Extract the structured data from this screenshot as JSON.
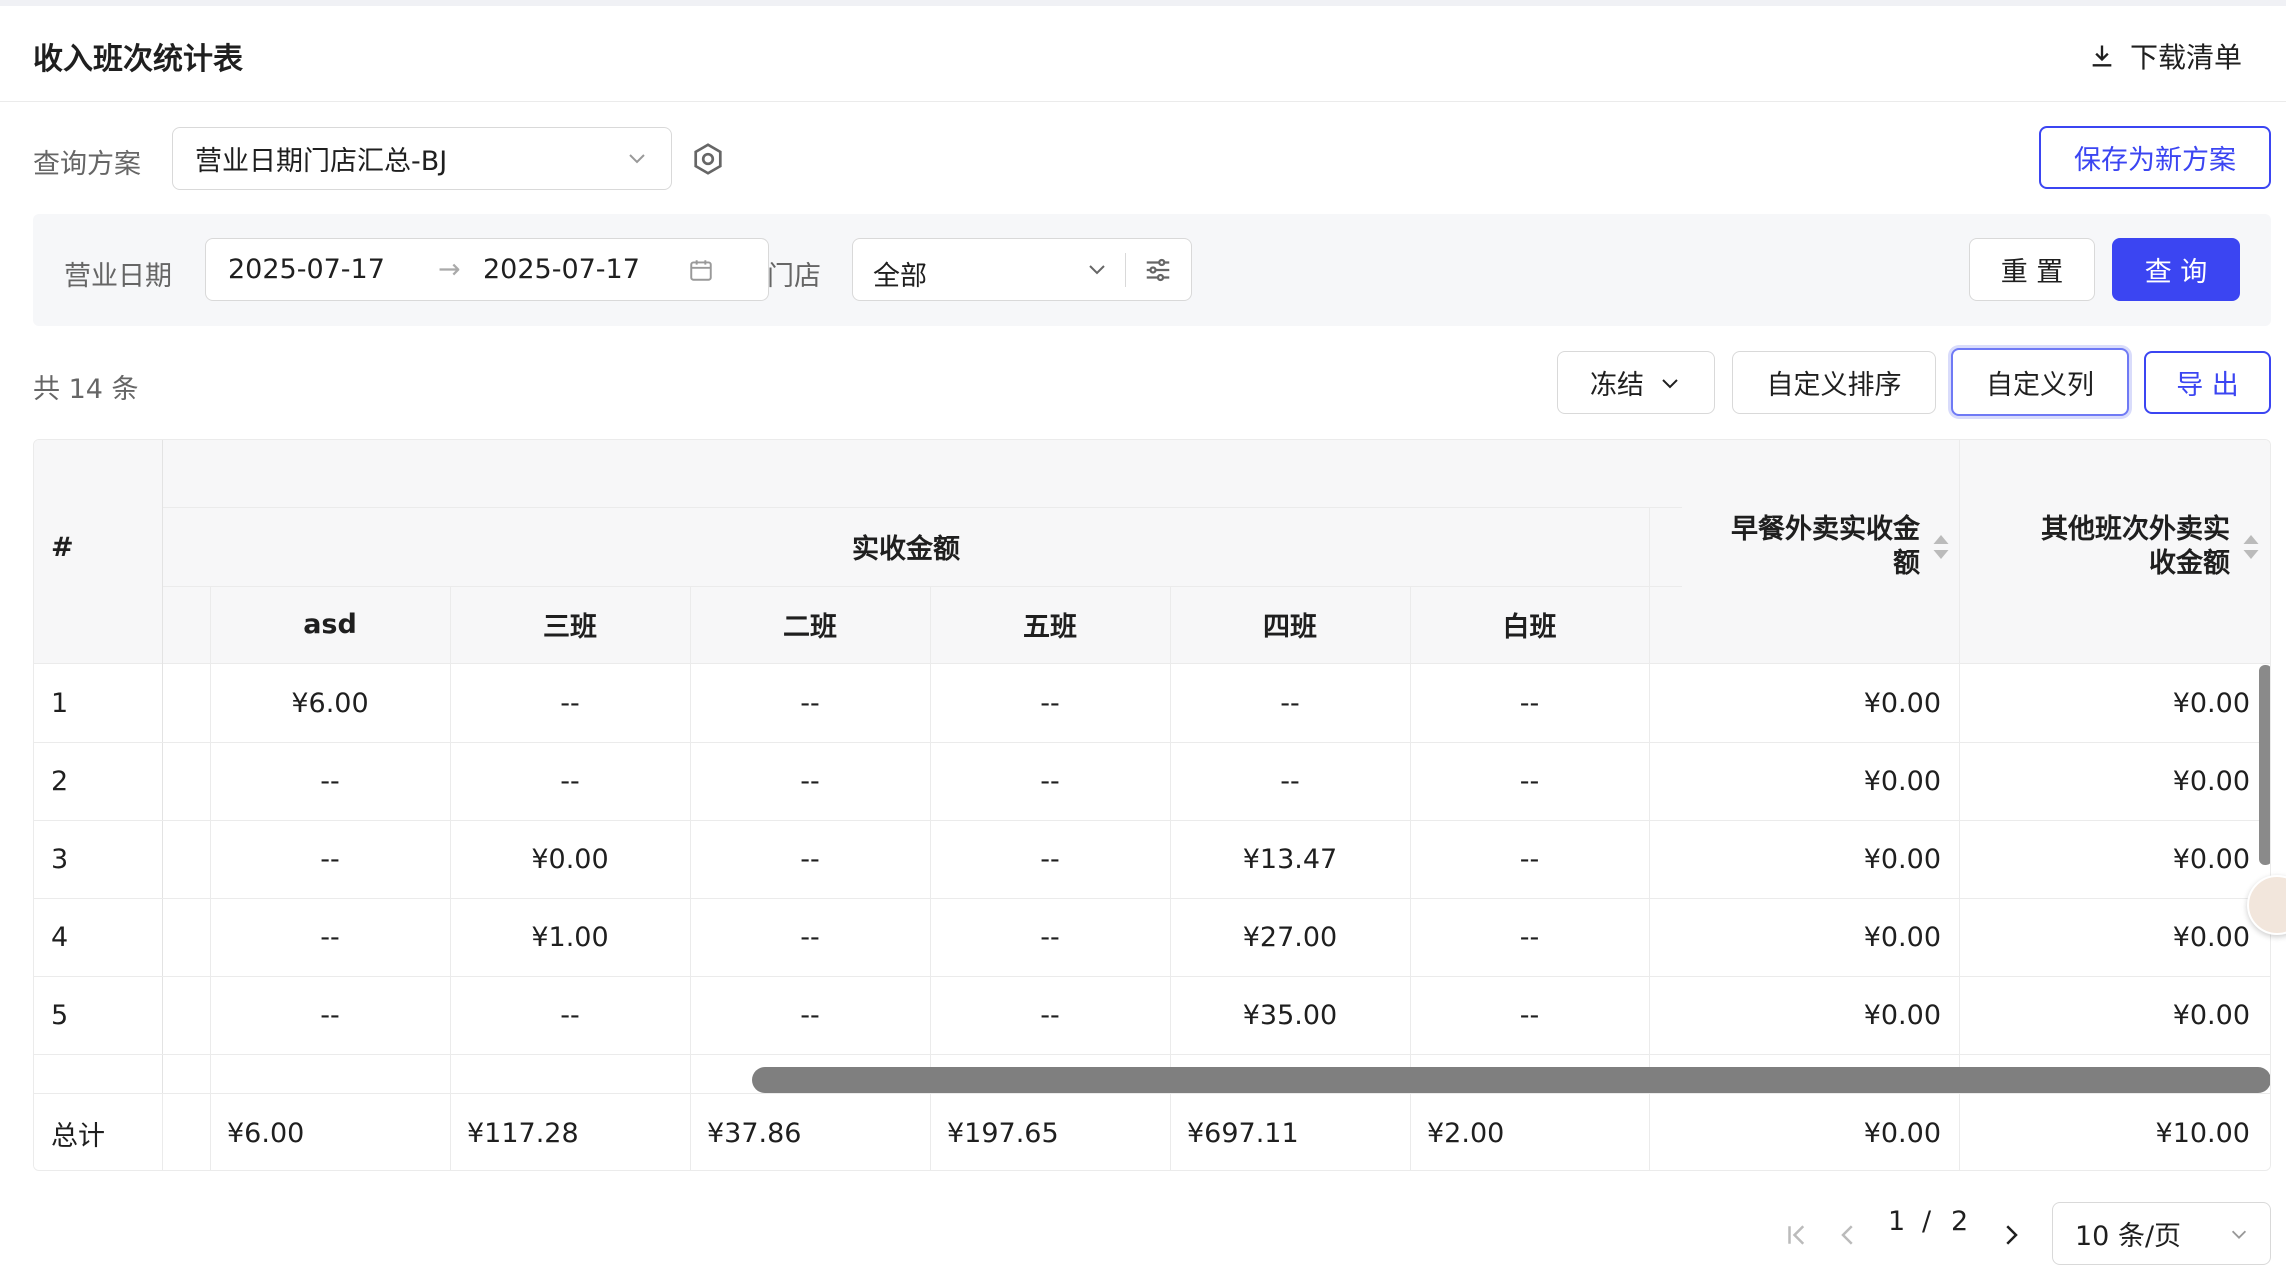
{
  "header": {
    "title": "收入班次统计表",
    "download_label": "下载清单"
  },
  "scheme": {
    "label": "查询方案",
    "value": "营业日期门店汇总-BJ",
    "save_label": "保存为新方案"
  },
  "filters": {
    "date_label": "营业日期",
    "date_start": "2025-07-17",
    "date_arrow": "→",
    "date_end": "2025-07-17",
    "store_label": "门店",
    "store_value": "全部",
    "reset_label": "重 置",
    "query_label": "查 询"
  },
  "toolbar": {
    "count": "共 14 条",
    "freeze_label": "冻结",
    "custom_sort_label": "自定义排序",
    "custom_cols_label": "自定义列",
    "export_label": "导 出"
  },
  "table": {
    "index_header": "#",
    "group_header": "实收金额",
    "sub_headers": [
      "asd",
      "三班",
      "二班",
      "五班",
      "四班",
      "白班"
    ],
    "col_breakfast_line1": "早餐外卖实收金",
    "col_breakfast_line2": "额",
    "col_other_line1": "其他班次外卖实",
    "col_other_line2": "收金额",
    "rows": [
      {
        "idx": "1",
        "vals": [
          "¥6.00",
          "--",
          "--",
          "--",
          "--",
          "--"
        ],
        "breakfast": "¥0.00",
        "other": "¥0.00"
      },
      {
        "idx": "2",
        "vals": [
          "--",
          "--",
          "--",
          "--",
          "--",
          "--"
        ],
        "breakfast": "¥0.00",
        "other": "¥0.00"
      },
      {
        "idx": "3",
        "vals": [
          "--",
          "¥0.00",
          "--",
          "--",
          "¥13.47",
          "--"
        ],
        "breakfast": "¥0.00",
        "other": "¥0.00"
      },
      {
        "idx": "4",
        "vals": [
          "--",
          "¥1.00",
          "--",
          "--",
          "¥27.00",
          "--"
        ],
        "breakfast": "¥0.00",
        "other": "¥0.00"
      },
      {
        "idx": "5",
        "vals": [
          "--",
          "--",
          "--",
          "--",
          "¥35.00",
          "--"
        ],
        "breakfast": "¥0.00",
        "other": "¥0.00"
      }
    ],
    "total_label": "总计",
    "totals": [
      "¥6.00",
      "¥117.28",
      "¥37.86",
      "¥197.65",
      "¥697.11",
      "¥2.00"
    ],
    "total_breakfast": "¥0.00",
    "total_other": "¥10.00"
  },
  "pagination": {
    "current": "1",
    "separator": "/",
    "total": "2",
    "page_size": "10 条/页"
  },
  "colors": {
    "primary": "#3b45f2",
    "border": "#d9d9d9",
    "header_bg": "#f7f7f8"
  }
}
